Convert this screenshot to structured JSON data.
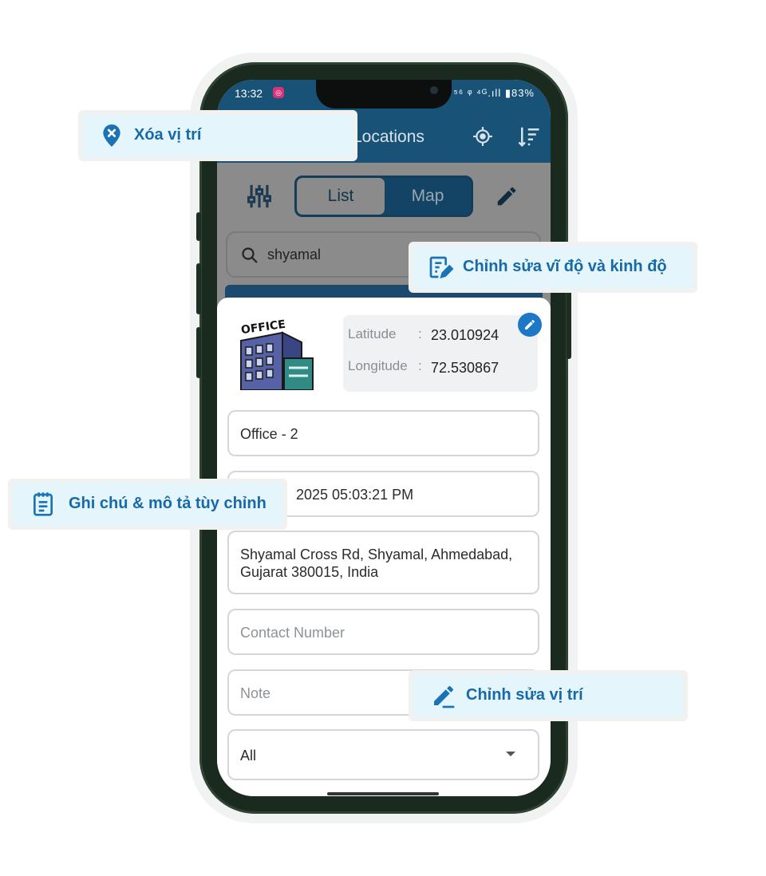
{
  "status_bar": {
    "time": "13:32",
    "right_icons": "⁵⁶ ᵠ ⁴ᴳ.ıll ▮83%"
  },
  "app_bar": {
    "title": "Locations",
    "gps_icon": "gps-target-icon",
    "sort_icon": "sort-icon"
  },
  "toolbar": {
    "filter_icon": "sliders-icon",
    "tabs": [
      "List",
      "Map"
    ],
    "active_tab": "List",
    "edit_icon": "pencil-icon"
  },
  "search": {
    "value": "shyamal"
  },
  "location_card": {
    "image_label": "OFFICE",
    "coords": {
      "latitude_label": "Latitude",
      "latitude": "23.010924",
      "longitude_label": "Longitude",
      "longitude": "72.530867",
      "separator": ":"
    },
    "name": "Office - 2",
    "datetime": "2025 05:03:21 PM",
    "address": "Shyamal Cross Rd, Shyamal, Ahmedabad, Gujarat 380015, India",
    "contact_placeholder": "Contact Number",
    "note_placeholder": "Note",
    "category_value": "All"
  },
  "callouts": {
    "delete_location": "Xóa vị trí",
    "edit_coords": "Chỉnh sửa vĩ độ và kinh độ",
    "notes": "Ghi chú & mô tả tùy chỉnh",
    "edit_location": "Chỉnh sửa vị trí"
  },
  "colors": {
    "primary": "#185277",
    "accent": "#1e78c8",
    "callout_text": "#1769a8",
    "callout_bg": "#e4f5fc"
  }
}
